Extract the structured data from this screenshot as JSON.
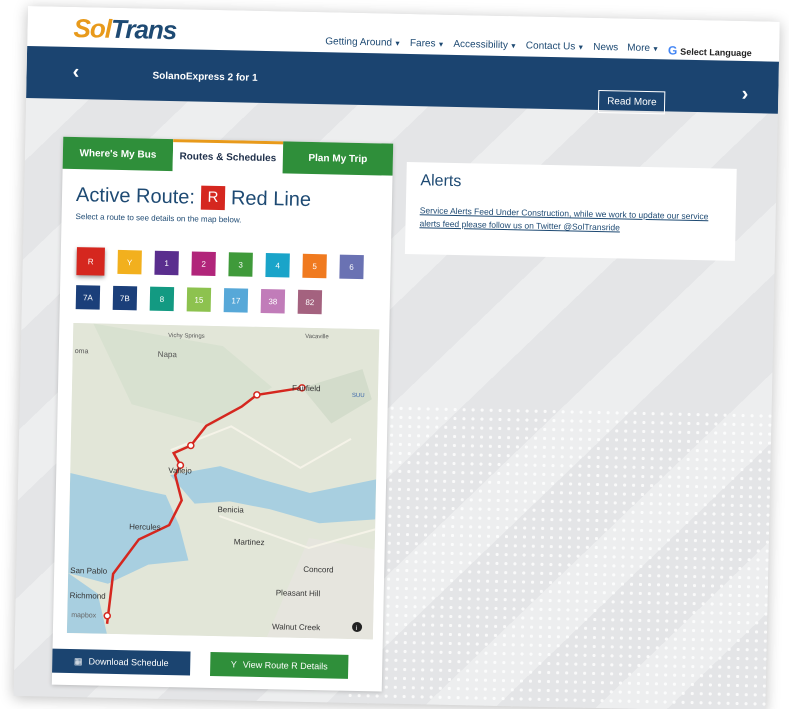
{
  "header": {
    "logo_part1": "Sol",
    "logo_part2": "Trans",
    "nav": [
      {
        "label": "Getting Around",
        "dropdown": true
      },
      {
        "label": "Fares",
        "dropdown": true
      },
      {
        "label": "Accessibility",
        "dropdown": true
      },
      {
        "label": "Contact Us",
        "dropdown": true
      },
      {
        "label": "News",
        "dropdown": false
      },
      {
        "label": "More",
        "dropdown": true
      }
    ],
    "google_icon": "G",
    "language_label": "Select Language"
  },
  "banner": {
    "title": "SolanoExpress 2 for 1",
    "read_more_label": "Read More",
    "prev_icon": "chevron-left-icon",
    "next_icon": "chevron-right-icon"
  },
  "tabs": [
    {
      "label": "Where's My Bus",
      "active": false
    },
    {
      "label": "Routes & Schedules",
      "active": true
    },
    {
      "label": "Plan My Trip",
      "active": false
    }
  ],
  "active_route": {
    "prefix": "Active Route:",
    "badge": "R",
    "name": "Red Line",
    "hint": "Select a route to see details on the map below."
  },
  "routes": [
    {
      "label": "R",
      "color": "#d5271f",
      "selected": true
    },
    {
      "label": "Y",
      "color": "#f2b01e",
      "selected": false
    },
    {
      "label": "1",
      "color": "#5a2e8e",
      "selected": false
    },
    {
      "label": "2",
      "color": "#b1257a",
      "selected": false
    },
    {
      "label": "3",
      "color": "#3f9a3a",
      "selected": false
    },
    {
      "label": "4",
      "color": "#1aa4c9",
      "selected": false
    },
    {
      "label": "5",
      "color": "#f07a1f",
      "selected": false
    },
    {
      "label": "6",
      "color": "#6a72b3",
      "selected": false
    },
    {
      "label": "7A",
      "color": "#1b3f7a",
      "selected": false
    },
    {
      "label": "7B",
      "color": "#1b3f7a",
      "selected": false
    },
    {
      "label": "8",
      "color": "#139a82",
      "selected": false
    },
    {
      "label": "15",
      "color": "#8dc24f",
      "selected": false
    },
    {
      "label": "17",
      "color": "#57a8d8",
      "selected": false
    },
    {
      "label": "38",
      "color": "#c17cb9",
      "selected": false
    },
    {
      "label": "82",
      "color": "#a4627f",
      "selected": false
    }
  ],
  "map": {
    "place_labels": [
      "Vichy Springs",
      "Vacaville",
      "Napa",
      "oma",
      "Fairfield",
      "SUU",
      "Vallejo",
      "Benicia",
      "Hercules",
      "Martinez",
      "Concord",
      "San Pablo",
      "Pleasant Hill",
      "Richmond",
      "Walnut Creek"
    ],
    "attribution": "mapbox",
    "info_icon": "info-icon"
  },
  "buttons": {
    "download_label": "Download Schedule",
    "details_label": "View Route R Details"
  },
  "alerts": {
    "title": "Alerts",
    "body": "Service Alerts Feed Under Construction, while we work to update our service alerts feed please follow us on Twitter @SolTransride"
  }
}
